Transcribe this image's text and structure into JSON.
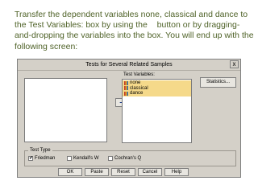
{
  "instructions": {
    "text_before_blank": "Transfer the dependent variables none, classical and dance to the Test Variables: box by using the",
    "text_after_blank": "button or by dragging-and-dropping the variables into the box. You will end up with the following screen:"
  },
  "dialog": {
    "title": "Tests for Several Related Samples",
    "close_symbol": "x",
    "move_arrow": "➜",
    "test_variables_label": "Test Variables:",
    "test_variables": [
      "none",
      "classical",
      "dance"
    ],
    "statistics_button": "Statistics...",
    "test_type_label": "Test Type",
    "checks": [
      {
        "label": "Friedman",
        "checked": true
      },
      {
        "label": "Kendall's W",
        "checked": false
      },
      {
        "label": "Cochran's Q",
        "checked": false
      }
    ],
    "buttons": [
      "OK",
      "Paste",
      "Reset",
      "Cancel",
      "Help"
    ],
    "icon": "scale-variable-icon"
  }
}
